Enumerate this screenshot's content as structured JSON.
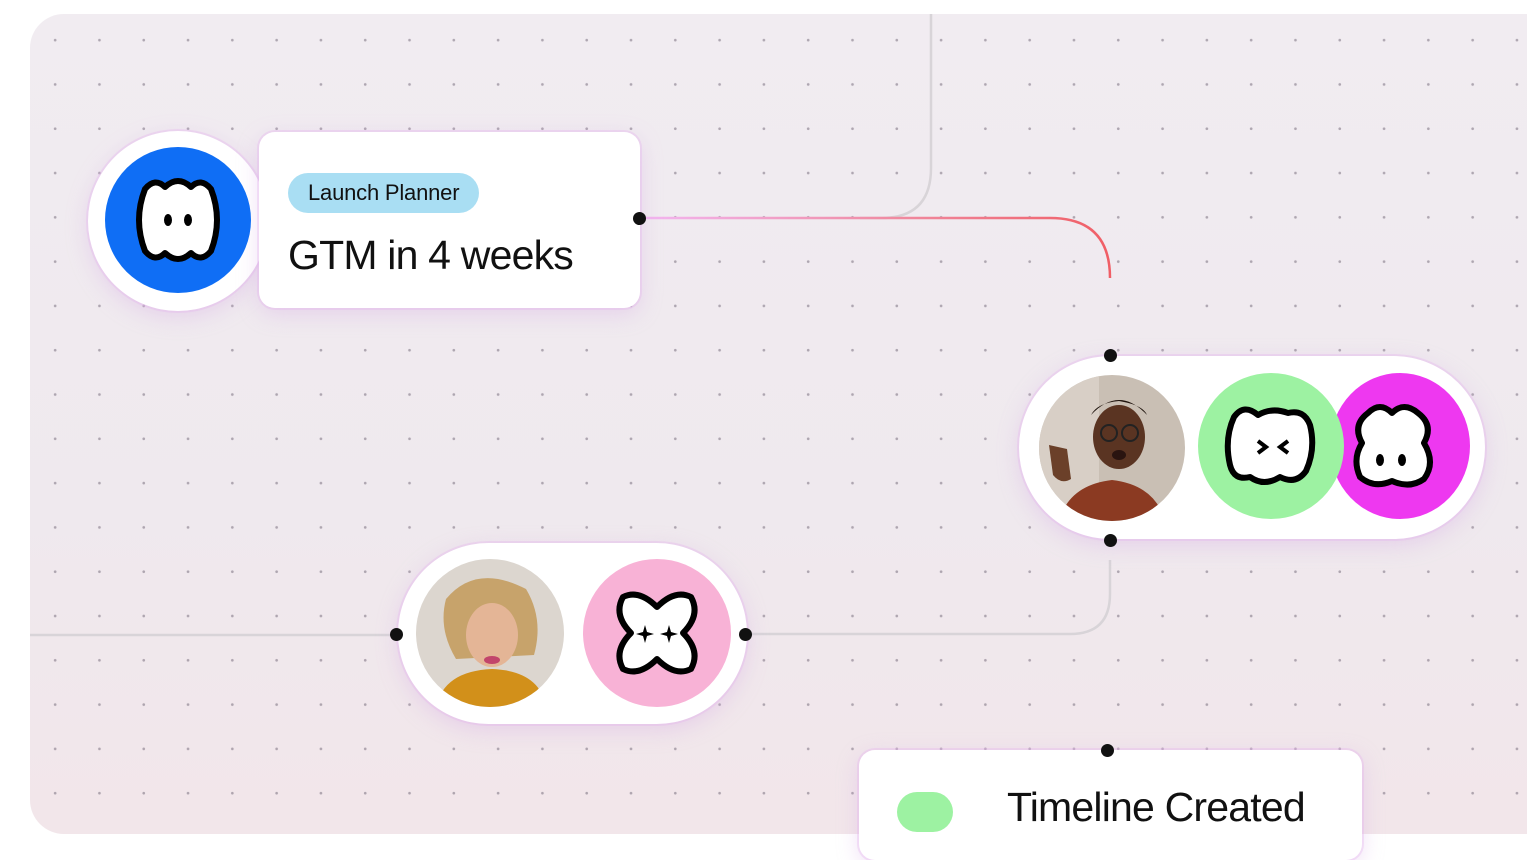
{
  "nodes": {
    "launch": {
      "tag": "Launch Planner",
      "title": "GTM in 4 weeks",
      "tag_color": "#a9def3",
      "icon_color": "#0f6ef5"
    },
    "timeline": {
      "title": "Timeline Created",
      "tag_color": "#9df2a2"
    }
  },
  "icons": {
    "blue_brand": "happy-face-icon",
    "green_brand": "wink-face-icon",
    "magenta_brand": "face-icon",
    "pink_brand": "sparkle-icon"
  },
  "colors": {
    "blue": "#0f6ef5",
    "green": "#9df2a2",
    "magenta": "#ee38f0",
    "pink": "#f8b2d6",
    "wire_gray": "#d8d4d8",
    "wire_pink": "#f2b6f2",
    "wire_red": "#f05e66"
  }
}
